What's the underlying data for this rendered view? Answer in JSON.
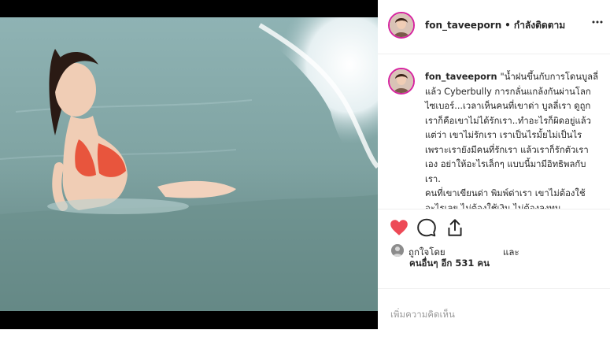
{
  "post": {
    "username": "fon_taveeporn",
    "follow_status": "• กำลังติดตาม",
    "more_icon": "more-horizontal-icon",
    "caption": "\"น้ำฝนขึ้นกับการโดนบูลลี่แล้ว Cyberbully การกลั่นแกล้งกันผ่านโลกไซเบอร์...เวลาเห็นคนที่เขาด่า บูลลี่เรา ดูถูกเราก็คือเขาไม่ได้รักเรา..ทำอะไรก็ผิดอยู่แล้ว แต่ว่า เขาไม่รักเรา เราเป็นไรมั้ยไม่เป็นไร เพราะเรายังมีคนที่รักเรา แล้วเราก็รักตัวเราเอง อย่าให้อะไรเล็กๆ แบบนี้มามีอิทธิพลกับเรา.\nคนที่เขาเขียนด่า พิมพ์ด่าเรา เขาไม่ต้องใช้อะไรเลย ไม่ต้องใช้เงิน ไม่ต้องลงทุน",
    "liked_by_label": "ถูกใจโดย",
    "and_label": "และ",
    "others_label": "คนอื่นๆ อีก 531 คน",
    "comment_placeholder": "เพิ่มความคิดเห็น",
    "icons": {
      "like": "heart-filled-icon",
      "comment": "comment-icon",
      "share": "share-icon"
    },
    "colors": {
      "like_red": "#ed4956",
      "avatar_ring": "#d6249f",
      "text": "#262626",
      "muted": "#999999"
    }
  }
}
